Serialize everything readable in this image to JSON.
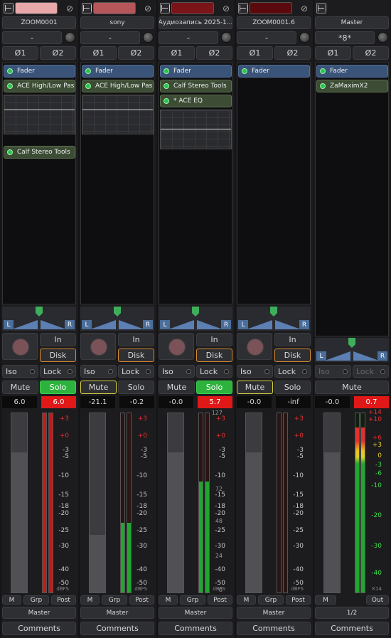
{
  "strips": [
    {
      "name": "ZOOM0001",
      "swatch": "#e8a8aa",
      "input": "-",
      "phase1": "Ø1",
      "phase2": "Ø2",
      "plugins": [
        {
          "label": "Fader",
          "kind": "fader"
        },
        {
          "label": "ACE High/Low Pas",
          "kind": "proc"
        },
        {
          "label": "Calf Stereo Tools",
          "kind": "proc"
        }
      ],
      "pan_left": "L",
      "pan_right": "R",
      "in": "In",
      "disk": "Disk",
      "iso": "Iso",
      "lock": "Lock",
      "mute": "Mute",
      "solo": "Solo",
      "gain": "6.0",
      "peak": "6.0",
      "peak_red": true,
      "scale": [
        "+3",
        "+0",
        "-3",
        "-5",
        "-10",
        "-15",
        "-18",
        "-20",
        "-25",
        "-30",
        "-40",
        "-50"
      ],
      "scale_unit": "dBFS",
      "meter_level": 1.0,
      "meter_color": "red",
      "m": "M",
      "grp": "Grp",
      "post": "Post",
      "output": "Master",
      "comments": "Comments"
    },
    {
      "name": "sony",
      "swatch": "#b5565a",
      "input": "-",
      "phase1": "Ø1",
      "phase2": "Ø2",
      "plugins": [
        {
          "label": "Fader",
          "kind": "fader"
        },
        {
          "label": "ACE High/Low Pas",
          "kind": "proc"
        }
      ],
      "pan_left": "L",
      "pan_right": "R",
      "in": "In",
      "disk": "Disk",
      "iso": "Iso",
      "lock": "Lock",
      "mute": "Mute",
      "solo": "Solo",
      "gain": "-21.1",
      "peak": "-0.2",
      "peak_red": false,
      "scale": [
        "+3",
        "+0",
        "-3",
        "-5",
        "-10",
        "-15",
        "-18",
        "-20",
        "-25",
        "-30",
        "-40",
        "-50"
      ],
      "scale_unit": "dBFS",
      "meter_level": 0.39,
      "meter_color": "green",
      "m": "M",
      "grp": "Grp",
      "post": "Post",
      "output": "Master",
      "comments": "Comments"
    },
    {
      "name": "Аудиозапись 2025-1...",
      "swatch": "#7a1418",
      "input": "-",
      "phase1": "Ø1",
      "phase2": "Ø2",
      "plugins": [
        {
          "label": "Fader",
          "kind": "fader"
        },
        {
          "label": "Calf Stereo Tools",
          "kind": "proc"
        },
        {
          "label": "* ACE EQ",
          "kind": "proc"
        }
      ],
      "pan_left": "L",
      "pan_right": "R",
      "in": "In",
      "disk": "Disk",
      "iso": "Iso",
      "lock": "Lock",
      "mute": "Mute",
      "solo": "Solo",
      "gain": "-0.0",
      "peak": "5.7",
      "peak_red": true,
      "scale": [
        "+3",
        "+0",
        "-3",
        "-5",
        "-10",
        "-15",
        "-18",
        "-20",
        "-25",
        "-30",
        "-40",
        "-50"
      ],
      "scale_unit": "dBFS",
      "midi_scale": [
        "127",
        "72",
        "48",
        "24",
        "0"
      ],
      "meter_level": 0.62,
      "meter_color": "green",
      "m": "M",
      "grp": "Grp",
      "post": "Post",
      "output": "Master",
      "comments": "Comments"
    },
    {
      "name": "ZOOM0001.6",
      "swatch": "#5a0a0c",
      "input": "-",
      "phase1": "Ø1",
      "phase2": "Ø2",
      "plugins": [
        {
          "label": "Fader",
          "kind": "fader"
        }
      ],
      "pan_left": "L",
      "pan_right": "R",
      "in": "In",
      "disk": "Disk",
      "iso": "Iso",
      "lock": "Lock",
      "mute": "Mute",
      "solo": "Solo",
      "gain": "-0.0",
      "peak": "-inf",
      "peak_red": false,
      "scale": [
        "+3",
        "+0",
        "-3",
        "-5",
        "-10",
        "-15",
        "-18",
        "-20",
        "-25",
        "-30",
        "-40",
        "-50"
      ],
      "scale_unit": "dBFS",
      "meter_level": 0.0,
      "meter_color": "green",
      "m": "M",
      "grp": "Grp",
      "post": "Post",
      "output": "Master",
      "comments": "Comments"
    }
  ],
  "master": {
    "name": "Master",
    "input": "*8*",
    "phase1": "Ø1",
    "phase2": "Ø2",
    "plugins": [
      {
        "label": "Fader",
        "kind": "fader"
      },
      {
        "label": "ZaMaximX2",
        "kind": "proc"
      }
    ],
    "pan_left": "L",
    "pan_right": "R",
    "iso": "Iso",
    "lock": "Lock",
    "mute": "Mute",
    "gain": "-0.0",
    "peak": "0.7",
    "peak_red": true,
    "scale": [
      "+14",
      "+10",
      "+6",
      "+3",
      "0",
      "-3",
      "-6",
      "-10",
      "-20",
      "-30",
      "-40"
    ],
    "scale_unit": "K14",
    "m": "M",
    "out": "Out",
    "output": "1/2",
    "comments": "Comments"
  }
}
